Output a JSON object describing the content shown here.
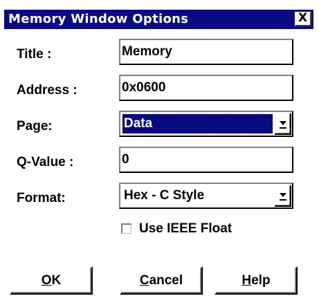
{
  "window": {
    "title": "Memory Window Options",
    "close_glyph": "X"
  },
  "fields": {
    "title": {
      "label": "Title :",
      "value": "Memory"
    },
    "address": {
      "label": "Address :",
      "value": "0x0600"
    },
    "page": {
      "label": "Page:",
      "value": "Data"
    },
    "qvalue": {
      "label": "Q-Value :",
      "value": "0"
    },
    "format": {
      "label": "Format:",
      "value": "Hex - C Style"
    }
  },
  "options": {
    "use_ieee_float": {
      "label": "Use IEEE Float",
      "checked": false
    }
  },
  "buttons": {
    "ok": {
      "mnemonic": "O",
      "rest": "K"
    },
    "cancel": {
      "mnemonic": "C",
      "rest": "ancel"
    },
    "help": {
      "mnemonic": "H",
      "rest": "elp"
    }
  },
  "colors": {
    "titlebar": "#0a0a80",
    "selection": "#0a0a80",
    "background": "#ffffff"
  },
  "icons": {
    "close": "close-icon",
    "dropdown": "chevron-down-icon"
  }
}
